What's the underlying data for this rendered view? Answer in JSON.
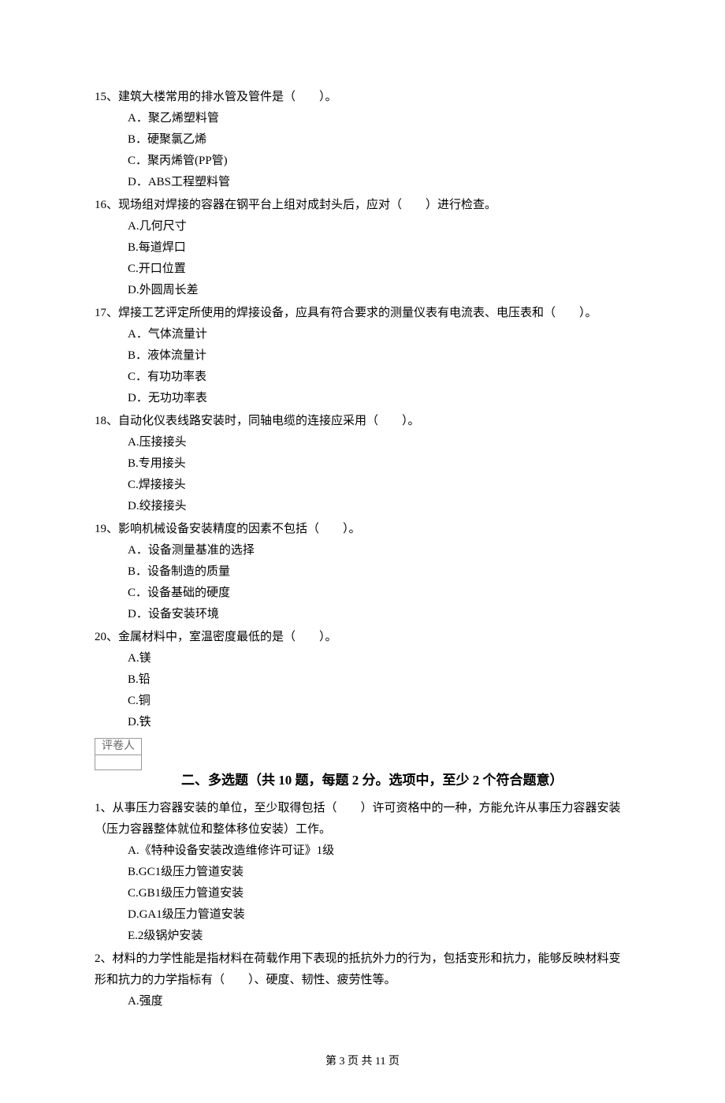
{
  "questions_single": [
    {
      "num": "15",
      "text": "、建筑大楼常用的排水管及管件是（　　）。",
      "opts": [
        "A．聚乙烯塑料管",
        "B．硬聚氯乙烯",
        "C．聚丙烯管(PP管)",
        "D．ABS工程塑料管"
      ]
    },
    {
      "num": "16",
      "text": "、现场组对焊接的容器在钢平台上组对成封头后，应对（　　）进行检查。",
      "opts": [
        "A.几何尺寸",
        "B.每道焊口",
        "C.开口位置",
        "D.外圆周长差"
      ]
    },
    {
      "num": "17",
      "text": "、焊接工艺评定所使用的焊接设备，应具有符合要求的测量仪表有电流表、电压表和（　　）。",
      "opts": [
        "A．气体流量计",
        "B．液体流量计",
        "C．有功功率表",
        "D．无功功率表"
      ]
    },
    {
      "num": "18",
      "text": "、自动化仪表线路安装时，同轴电缆的连接应采用（　　）。",
      "opts": [
        "A.压接接头",
        "B.专用接头",
        "C.焊接接头",
        "D.绞接接头"
      ]
    },
    {
      "num": "19",
      "text": "、影响机械设备安装精度的因素不包括（　　）。",
      "opts": [
        "A．设备测量基准的选择",
        "B．设备制造的质量",
        "C．设备基础的硬度",
        "D．设备安装环境"
      ]
    },
    {
      "num": "20",
      "text": "、金属材料中，室温密度最低的是（　　）。",
      "opts": [
        "A.镁",
        "B.铅",
        "C.铜",
        "D.铁"
      ]
    }
  ],
  "grader_label": "评卷人",
  "section2_header": "二、多选题（共 10 题，每题 2 分。选项中，至少 2 个符合题意）",
  "questions_multi": [
    {
      "num": "1",
      "text": "、从事压力容器安装的单位，至少取得包括（　　）许可资格中的一种，方能允许从事压力容器安装（压力容器整体就位和整体移位安装）工作。",
      "opts": [
        "A.《特种设备安装改造维修许可证》1级",
        "B.GC1级压力管道安装",
        "C.GB1级压力管道安装",
        "D.GA1级压力管道安装",
        "E.2级锅炉安装"
      ]
    },
    {
      "num": "2",
      "text": "、材料的力学性能是指材料在荷载作用下表现的抵抗外力的行为，包括变形和抗力，能够反映材料变形和抗力的力学指标有（　　）、硬度、韧性、疲劳性等。",
      "opts": [
        "A.强度"
      ]
    }
  ],
  "footer": "第 3 页 共 11 页"
}
